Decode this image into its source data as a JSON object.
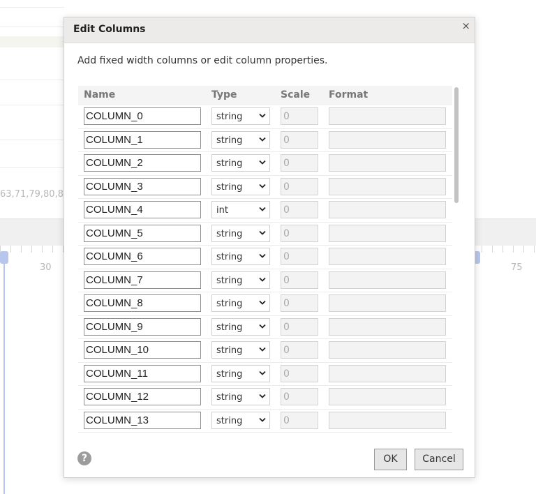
{
  "background": {
    "sequence_text": "63,71,79,80,8",
    "ruler_ticks": [
      "30",
      "75"
    ]
  },
  "dialog": {
    "title": "Edit Columns",
    "close_symbol": "×",
    "description": "Add fixed width columns or edit column properties.",
    "table": {
      "headers": {
        "name": "Name",
        "type": "Type",
        "scale": "Scale",
        "format": "Format"
      },
      "rows": [
        {
          "name": "COLUMN_0",
          "type": "string",
          "scale": "0",
          "format": ""
        },
        {
          "name": "COLUMN_1",
          "type": "string",
          "scale": "0",
          "format": ""
        },
        {
          "name": "COLUMN_2",
          "type": "string",
          "scale": "0",
          "format": ""
        },
        {
          "name": "COLUMN_3",
          "type": "string",
          "scale": "0",
          "format": ""
        },
        {
          "name": "COLUMN_4",
          "type": "int",
          "scale": "0",
          "format": ""
        },
        {
          "name": "COLUMN_5",
          "type": "string",
          "scale": "0",
          "format": ""
        },
        {
          "name": "COLUMN_6",
          "type": "string",
          "scale": "0",
          "format": ""
        },
        {
          "name": "COLUMN_7",
          "type": "string",
          "scale": "0",
          "format": ""
        },
        {
          "name": "COLUMN_8",
          "type": "string",
          "scale": "0",
          "format": ""
        },
        {
          "name": "COLUMN_9",
          "type": "string",
          "scale": "0",
          "format": ""
        },
        {
          "name": "COLUMN_10",
          "type": "string",
          "scale": "0",
          "format": ""
        },
        {
          "name": "COLUMN_11",
          "type": "string",
          "scale": "0",
          "format": ""
        },
        {
          "name": "COLUMN_12",
          "type": "string",
          "scale": "0",
          "format": ""
        },
        {
          "name": "COLUMN_13",
          "type": "string",
          "scale": "0",
          "format": ""
        }
      ]
    },
    "help_symbol": "?",
    "buttons": {
      "ok": "OK",
      "cancel": "Cancel"
    }
  },
  "icons": {
    "close": "close-icon",
    "help": "help-icon",
    "dropdown": "chevron-down-icon"
  }
}
